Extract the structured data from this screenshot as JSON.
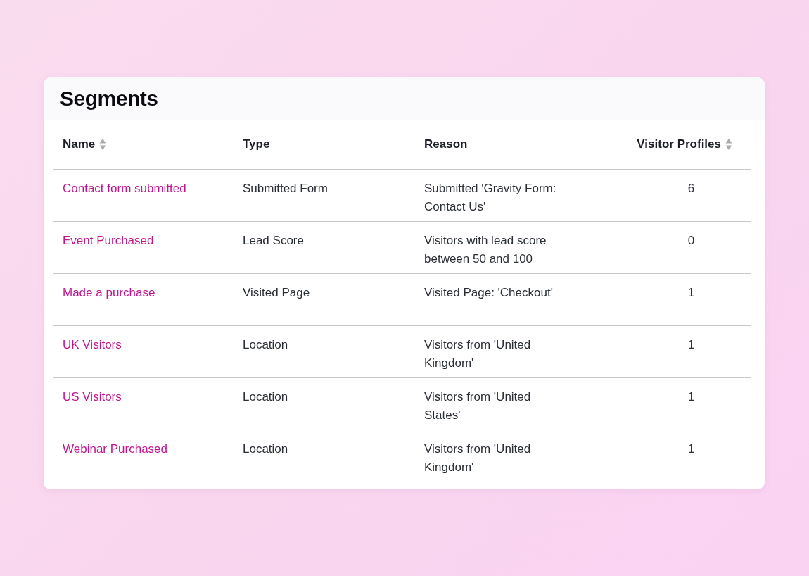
{
  "title": "Segments",
  "columns": [
    {
      "label": "Name",
      "sortable": true
    },
    {
      "label": "Type",
      "sortable": false
    },
    {
      "label": "Reason",
      "sortable": false
    },
    {
      "label": "Visitor Profiles",
      "sortable": true
    }
  ],
  "rows": [
    {
      "name": "Contact form submitted",
      "type": "Submitted Form",
      "reason": "Submitted 'Gravity Form: Contact Us'",
      "profiles": "6"
    },
    {
      "name": "Event Purchased",
      "type": "Lead Score",
      "reason": "Visitors with lead score between 50 and 100",
      "profiles": "0"
    },
    {
      "name": "Made a purchase",
      "type": "Visited Page",
      "reason": "Visited Page: 'Checkout'",
      "profiles": "1"
    },
    {
      "name": "UK Visitors",
      "type": "Location",
      "reason": "Visitors from 'United Kingdom'",
      "profiles": "1"
    },
    {
      "name": "US Visitors",
      "type": "Location",
      "reason": "Visitors from 'United States'",
      "profiles": "1"
    },
    {
      "name": "Webinar Purchased",
      "type": "Location",
      "reason": "Visitors from 'United Kingdom'",
      "profiles": "1"
    }
  ]
}
